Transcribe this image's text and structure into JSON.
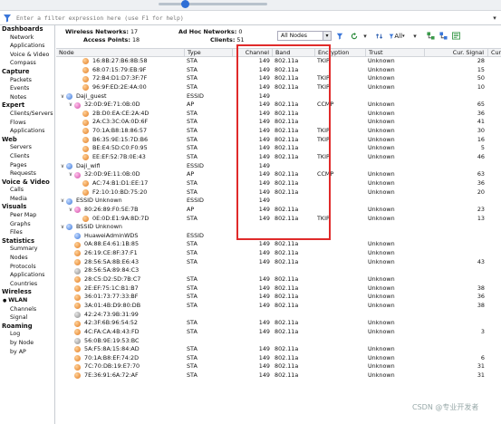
{
  "filter": {
    "placeholder": "Enter a filter expression here (use F1 for help)"
  },
  "sidebar": {
    "categories": [
      {
        "title": "Dashboards",
        "items": [
          "Network",
          "Applications",
          "Voice & Video",
          "Compass"
        ]
      },
      {
        "title": "Capture",
        "items": [
          "Packets",
          "Events",
          "Notes"
        ]
      },
      {
        "title": "Expert",
        "items": [
          "Clients/Servers",
          "Flows",
          "Applications"
        ]
      },
      {
        "title": "Web",
        "items": [
          "Servers",
          "Clients",
          "Pages",
          "Requests"
        ]
      },
      {
        "title": "Voice & Video",
        "items": [
          "Calls",
          "Media"
        ]
      },
      {
        "title": "Visuals",
        "items": [
          "Peer Map",
          "Graphs",
          "Files"
        ]
      },
      {
        "title": "Statistics",
        "items": [
          "Summary",
          "Nodes",
          "Protocols",
          "Applications",
          "Countries"
        ]
      },
      {
        "title": "Wireless",
        "items": [
          "WLAN",
          "Channels",
          "Signal"
        ],
        "selected": "WLAN"
      },
      {
        "title": "Roaming",
        "items": [
          "Log",
          "by Node",
          "by AP"
        ]
      }
    ]
  },
  "stats": {
    "wireless_networks_label": "Wireless Networks:",
    "wireless_networks": "17",
    "access_points_label": "Access Points:",
    "access_points": "18",
    "adhoc_label": "Ad Hoc Networks:",
    "adhoc": "0",
    "clients_label": "Clients:",
    "clients": "51"
  },
  "toolbar": {
    "nodes_filter": "All Nodes",
    "all_label": "All"
  },
  "columns": [
    "Node",
    "Type",
    "Channel",
    "Band",
    "Encryption",
    "Trust",
    "Cur. Signal",
    "Cur. N"
  ],
  "rows": [
    {
      "indent": 2,
      "icon": "orange",
      "node": "16:8B:27:B6:8B:58",
      "type": "STA",
      "channel": "149",
      "band": "802.11a",
      "enc": "TKIP",
      "trust": "Unknown",
      "sig": "28"
    },
    {
      "indent": 2,
      "icon": "orange",
      "node": "68:07:15:79:EB:9F",
      "type": "STA",
      "channel": "149",
      "band": "802.11a",
      "enc": "",
      "trust": "Unknown",
      "sig": "15"
    },
    {
      "indent": 2,
      "icon": "orange",
      "node": "72:B4:D1:D7:3F:7F",
      "type": "STA",
      "channel": "149",
      "band": "802.11a",
      "enc": "TKIP",
      "trust": "Unknown",
      "sig": "50"
    },
    {
      "indent": 2,
      "icon": "orange",
      "node": "96:9F:ED:2E:4A:00",
      "type": "STA",
      "channel": "149",
      "band": "802.11a",
      "enc": "TKIP",
      "trust": "Unknown",
      "sig": "10"
    },
    {
      "indent": 0,
      "chev": "v",
      "icon": "blue",
      "node": "Daji_guest",
      "type": "ESSID",
      "channel": "149",
      "band": "",
      "enc": "",
      "trust": "",
      "sig": ""
    },
    {
      "indent": 1,
      "chev": "v",
      "icon": "pink",
      "node": "32:0D:9E:71:0B:0D",
      "type": "AP",
      "channel": "149",
      "band": "802.11a",
      "enc": "CCMP",
      "trust": "Unknown",
      "sig": "65"
    },
    {
      "indent": 2,
      "icon": "orange",
      "node": "2B:D0:EA:CE:2A:4D",
      "type": "STA",
      "channel": "149",
      "band": "802.11a",
      "enc": "",
      "trust": "Unknown",
      "sig": "36"
    },
    {
      "indent": 2,
      "icon": "orange",
      "node": "2A:C3:3C:0A:0D:6F",
      "type": "STA",
      "channel": "149",
      "band": "802.11a",
      "enc": "",
      "trust": "Unknown",
      "sig": "41"
    },
    {
      "indent": 2,
      "icon": "orange",
      "node": "70:1A:B8:18:86:57",
      "type": "STA",
      "channel": "149",
      "band": "802.11a",
      "enc": "TKIP",
      "trust": "Unknown",
      "sig": "30"
    },
    {
      "indent": 2,
      "icon": "orange",
      "node": "B6:35:9E:15:7D:B6",
      "type": "STA",
      "channel": "149",
      "band": "802.11a",
      "enc": "TKIP",
      "trust": "Unknown",
      "sig": "16"
    },
    {
      "indent": 2,
      "icon": "orange",
      "node": "BE:E4:5D:C0:F0:95",
      "type": "STA",
      "channel": "149",
      "band": "802.11a",
      "enc": "",
      "trust": "Unknown",
      "sig": "5"
    },
    {
      "indent": 2,
      "icon": "orange",
      "node": "EE:EF:52:7B:0E:43",
      "type": "STA",
      "channel": "149",
      "band": "802.11a",
      "enc": "TKIP",
      "trust": "Unknown",
      "sig": "46"
    },
    {
      "indent": 0,
      "chev": "v",
      "icon": "blue",
      "node": "Daji_wifi",
      "type": "ESSID",
      "channel": "149",
      "band": "",
      "enc": "",
      "trust": "",
      "sig": ""
    },
    {
      "indent": 1,
      "chev": "v",
      "icon": "pink",
      "node": "32:0D:9E:11:0B:0D",
      "type": "AP",
      "channel": "149",
      "band": "802.11a",
      "enc": "CCMP",
      "trust": "Unknown",
      "sig": "63"
    },
    {
      "indent": 2,
      "icon": "orange",
      "node": "AC:74:B1:D1:EE:17",
      "type": "STA",
      "channel": "149",
      "band": "802.11a",
      "enc": "",
      "trust": "Unknown",
      "sig": "36"
    },
    {
      "indent": 2,
      "icon": "orange",
      "node": "F2:10:10:BD:75:20",
      "type": "STA",
      "channel": "149",
      "band": "802.11a",
      "enc": "",
      "trust": "Unknown",
      "sig": "20"
    },
    {
      "indent": 0,
      "chev": "v",
      "icon": "blue",
      "node": "ESSID Unknown",
      "type": "ESSID",
      "channel": "149",
      "band": "",
      "enc": "",
      "trust": "",
      "sig": ""
    },
    {
      "indent": 1,
      "chev": "v",
      "icon": "pink",
      "node": "80:26:89:F0:5E:7B",
      "type": "AP",
      "channel": "149",
      "band": "802.11a",
      "enc": "",
      "trust": "Unknown",
      "sig": "23"
    },
    {
      "indent": 2,
      "icon": "orange",
      "node": "0E:0D:E1:9A:8D:7D",
      "type": "STA",
      "channel": "149",
      "band": "802.11a",
      "enc": "TKIP",
      "trust": "Unknown",
      "sig": "13"
    },
    {
      "indent": 0,
      "chev": "v",
      "icon": "blue",
      "node": "BSSID Unknown",
      "type": "",
      "channel": "",
      "band": "",
      "enc": "",
      "trust": "",
      "sig": ""
    },
    {
      "indent": 1,
      "icon": "blue",
      "node": "HuaweiAdminWDS",
      "type": "ESSID",
      "channel": "",
      "band": "",
      "enc": "",
      "trust": "",
      "sig": ""
    },
    {
      "indent": 1,
      "icon": "orange",
      "node": "0A:88:E4:61:1B:85",
      "type": "STA",
      "channel": "149",
      "band": "802.11a",
      "enc": "",
      "trust": "Unknown",
      "sig": ""
    },
    {
      "indent": 1,
      "icon": "orange",
      "node": "26:19:CE:8F:37:F1",
      "type": "STA",
      "channel": "149",
      "band": "802.11a",
      "enc": "",
      "trust": "Unknown",
      "sig": ""
    },
    {
      "indent": 1,
      "icon": "orange",
      "node": "28:56:5A:8B:E6:43",
      "type": "STA",
      "channel": "149",
      "band": "802.11a",
      "enc": "",
      "trust": "Unknown",
      "sig": "43"
    },
    {
      "indent": 1,
      "icon": "gray",
      "node": "28:56:5A:89:84:C3",
      "type": "",
      "channel": "",
      "band": "",
      "enc": "",
      "trust": "",
      "sig": ""
    },
    {
      "indent": 1,
      "icon": "orange",
      "node": "28:C5:D2:5D:7B:C7",
      "type": "STA",
      "channel": "149",
      "band": "802.11a",
      "enc": "",
      "trust": "Unknown",
      "sig": ""
    },
    {
      "indent": 1,
      "icon": "orange",
      "node": "2E:EF:75:1C:B1:B7",
      "type": "STA",
      "channel": "149",
      "band": "802.11a",
      "enc": "",
      "trust": "Unknown",
      "sig": "38"
    },
    {
      "indent": 1,
      "icon": "orange",
      "node": "36:01:73:77:33:BF",
      "type": "STA",
      "channel": "149",
      "band": "802.11a",
      "enc": "",
      "trust": "Unknown",
      "sig": "36"
    },
    {
      "indent": 1,
      "icon": "orange",
      "node": "3A:01:4B:D9:80:DB",
      "type": "STA",
      "channel": "149",
      "band": "802.11a",
      "enc": "",
      "trust": "Unknown",
      "sig": "38"
    },
    {
      "indent": 1,
      "icon": "gray",
      "node": "42:24:73:9B:31:99",
      "type": "",
      "channel": "",
      "band": "",
      "enc": "",
      "trust": "",
      "sig": ""
    },
    {
      "indent": 1,
      "icon": "orange",
      "node": "42:3F:6B:96:54:52",
      "type": "STA",
      "channel": "149",
      "band": "802.11a",
      "enc": "",
      "trust": "Unknown",
      "sig": ""
    },
    {
      "indent": 1,
      "icon": "orange",
      "node": "4C:FA:CA:4B:43:FD",
      "type": "STA",
      "channel": "149",
      "band": "802.11a",
      "enc": "",
      "trust": "Unknown",
      "sig": "3"
    },
    {
      "indent": 1,
      "icon": "gray",
      "node": "56:0B:9E:19:53:BC",
      "type": "",
      "channel": "",
      "band": "",
      "enc": "",
      "trust": "",
      "sig": ""
    },
    {
      "indent": 1,
      "icon": "orange",
      "node": "5A:F5:8A:15:84:AD",
      "type": "STA",
      "channel": "149",
      "band": "802.11a",
      "enc": "",
      "trust": "Unknown",
      "sig": ""
    },
    {
      "indent": 1,
      "icon": "orange",
      "node": "70:1A:B8:EF:74:2D",
      "type": "STA",
      "channel": "149",
      "band": "802.11a",
      "enc": "",
      "trust": "Unknown",
      "sig": "6"
    },
    {
      "indent": 1,
      "icon": "orange",
      "node": "7C:70:DB:19:E7:70",
      "type": "STA",
      "channel": "149",
      "band": "802.11a",
      "enc": "",
      "trust": "Unknown",
      "sig": "31"
    },
    {
      "indent": 1,
      "icon": "orange",
      "node": "7E:36:91:6A:72:AF",
      "type": "STA",
      "channel": "149",
      "band": "802.11a",
      "enc": "",
      "trust": "Unknown",
      "sig": "31"
    }
  ],
  "watermark": "CSDN @专业开发者",
  "colors": {
    "highlight": "#e02a2a",
    "accent": "#2f6fd6"
  }
}
